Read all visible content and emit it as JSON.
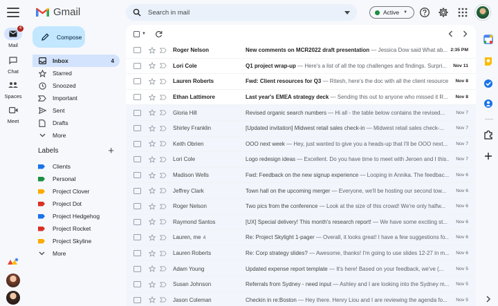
{
  "app": {
    "name": "Gmail"
  },
  "rail": {
    "items": [
      {
        "label": "Mail",
        "badge": "4",
        "icon": "mail-icon"
      },
      {
        "label": "Chat",
        "icon": "chat-icon"
      },
      {
        "label": "Spaces",
        "icon": "spaces-icon"
      },
      {
        "label": "Meet",
        "icon": "meet-icon"
      }
    ]
  },
  "search": {
    "placeholder": "Search in mail"
  },
  "status": {
    "label": "Active",
    "color": "#1e8e3e"
  },
  "compose": {
    "label": "Compose"
  },
  "nav": [
    {
      "label": "Inbox",
      "count": "4",
      "icon": "inbox-icon"
    },
    {
      "label": "Starred",
      "count": "",
      "icon": "star-icon"
    },
    {
      "label": "Snoozed",
      "count": "",
      "icon": "clock-icon"
    },
    {
      "label": "Important",
      "count": "",
      "icon": "important-icon"
    },
    {
      "label": "Sent",
      "count": "",
      "icon": "send-icon"
    },
    {
      "label": "Drafts",
      "count": "",
      "icon": "draft-icon"
    },
    {
      "label": "More",
      "count": "",
      "icon": "chevron-down-icon"
    }
  ],
  "labels": {
    "title": "Labels",
    "items": [
      {
        "label": "Clients",
        "color": "#1a73e8"
      },
      {
        "label": "Personal",
        "color": "#1e8e3e"
      },
      {
        "label": "Project Clover",
        "color": "#f9ab00"
      },
      {
        "label": "Project Dot",
        "color": "#d93025"
      },
      {
        "label": "Project Hedgehog",
        "color": "#1a73e8"
      },
      {
        "label": "Project Rocket",
        "color": "#d93025"
      },
      {
        "label": "Project Skyline",
        "color": "#f9ab00"
      },
      {
        "label": "More",
        "color": ""
      }
    ]
  },
  "emails": [
    {
      "sender": "Roger Nelson",
      "count": "",
      "subject": "New comments on MCR2022 draft presentation",
      "snippet": " — Jessica Dow said What ab...",
      "date": "2:35 PM",
      "unread": true
    },
    {
      "sender": "Lori Cole",
      "count": "",
      "subject": "Q1 project wrap-up",
      "snippet": " — Here's a list of all the top challenges and findings. Surpri...",
      "date": "Nov 11",
      "unread": true
    },
    {
      "sender": "Lauren Roberts",
      "count": "",
      "subject": "Fwd: Client resources for Q3",
      "snippet": " — Ritesh, here's the doc with all the client resource...",
      "date": "Nov 8",
      "unread": true
    },
    {
      "sender": "Ethan Lattimore",
      "count": "",
      "subject": "Last year's EMEA strategy deck",
      "snippet": " — Sending this out to anyone who missed it R...",
      "date": "Nov 8",
      "unread": true
    },
    {
      "sender": "Gloria Hill",
      "count": "",
      "subject": "Revised organic search numbers",
      "snippet": " — Hi all - the table below contains the revised...",
      "date": "Nov 7",
      "unread": false
    },
    {
      "sender": "Shirley Franklin",
      "count": "",
      "subject": "[Updated invitation] Midwest retail sales check-in",
      "snippet": " — Midwest retail sales check-...",
      "date": "Nov 7",
      "unread": false
    },
    {
      "sender": "Keith Obrien",
      "count": "",
      "subject": "OOO next week",
      "snippet": " — Hey, just wanted to give you a heads-up that I'll be OOO next...",
      "date": "Nov 7",
      "unread": false
    },
    {
      "sender": "Lori Cole",
      "count": "",
      "subject": "Logo redesign ideas",
      "snippet": " — Excellent. Do you have time to meet with Jeroen and I this...",
      "date": "Nov 7",
      "unread": false
    },
    {
      "sender": "Madison Wells",
      "count": "",
      "subject": "Fwd: Feedback on the new signup experience",
      "snippet": " — Looping in Annika. The feedbac...",
      "date": "Nov 6",
      "unread": false
    },
    {
      "sender": "Jeffrey Clark",
      "count": "",
      "subject": "Town hall on the upcoming merger",
      "snippet": " — Everyone, we'll be hosting our second tow...",
      "date": "Nov 6",
      "unread": false
    },
    {
      "sender": "Roger Nelson",
      "count": "",
      "subject": "Two pics from the conference",
      "snippet": " — Look at the size of this crowd! We're only halfw...",
      "date": "Nov 6",
      "unread": false
    },
    {
      "sender": "Raymond Santos",
      "count": "",
      "subject": "[UX] Special delivery! This month's research report!",
      "snippet": " — We have some exciting st...",
      "date": "Nov 6",
      "unread": false
    },
    {
      "sender": "Lauren, me",
      "count": "4",
      "subject": "Re: Project Skylight 1-pager",
      "snippet": " — Overall, it looks great! I have a few suggestions fo...",
      "date": "Nov 6",
      "unread": false
    },
    {
      "sender": "Lauren Roberts",
      "count": "",
      "subject": "Re: Corp strategy slides?",
      "snippet": " — Awesome, thanks! I'm going to use slides 12-27 in m...",
      "date": "Nov 6",
      "unread": false
    },
    {
      "sender": "Adam Young",
      "count": "",
      "subject": "Updated expense report template",
      "snippet": " — It's here! Based on your feedback, we've (...",
      "date": "Nov 5",
      "unread": false
    },
    {
      "sender": "Susan Johnson",
      "count": "",
      "subject": "Referrals from Sydney - need input",
      "snippet": " — Ashley and I are looking into the Sydney m...",
      "date": "Nov 5",
      "unread": false
    },
    {
      "sender": "Jason Coleman",
      "count": "",
      "subject": "Checkin in re:Boston",
      "snippet": " — Hey there. Henry Liou and I are reviewing the agenda fo...",
      "date": "Nov 5",
      "unread": false
    }
  ]
}
